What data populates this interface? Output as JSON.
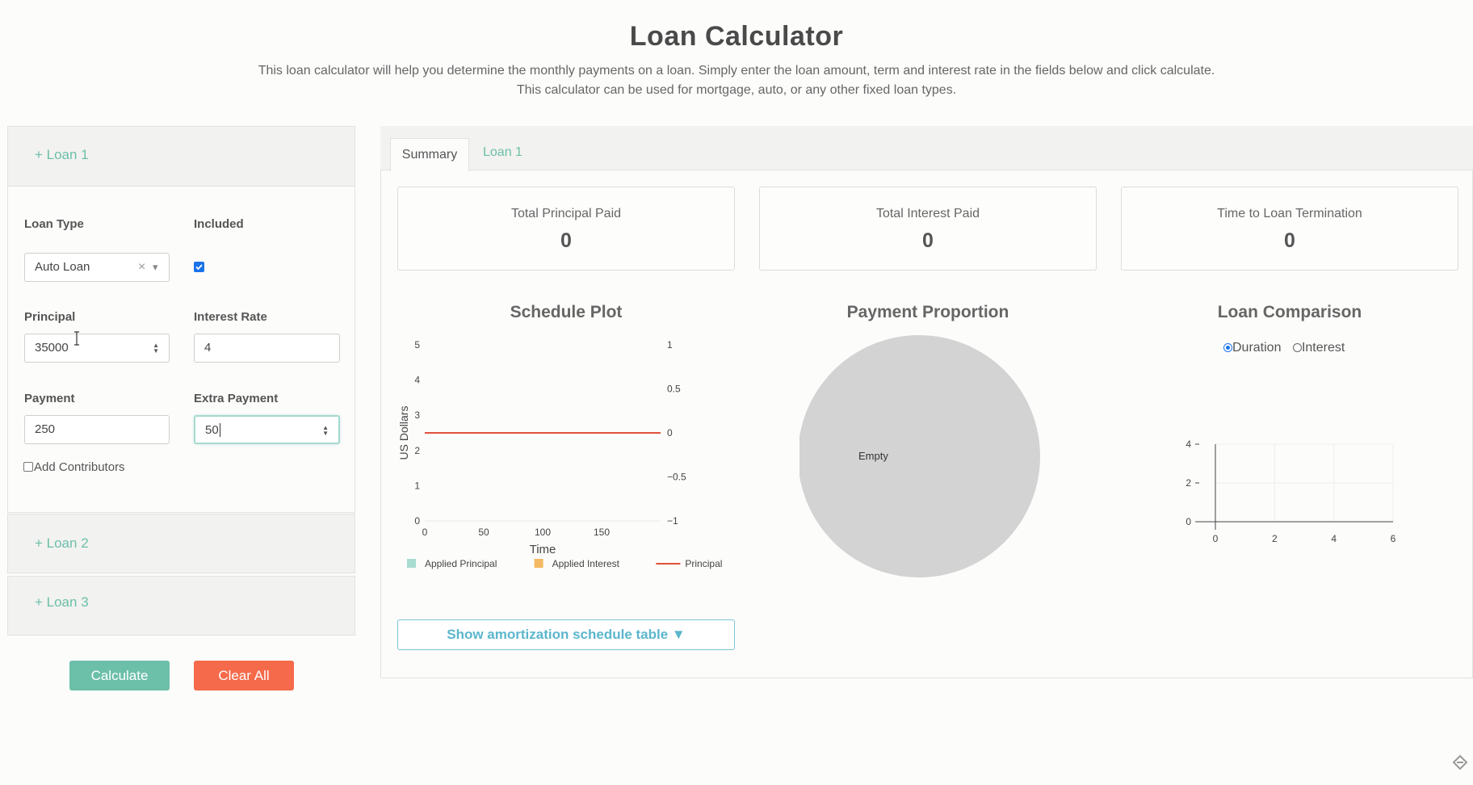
{
  "header": {
    "title": "Loan Calculator",
    "subtitle_line1": "This loan calculator will help you determine the monthly payments on a loan. Simply enter the loan amount, term and interest rate in the fields below and click calculate.",
    "subtitle_line2": "This calculator can be used for mortgage, auto, or any other fixed loan types."
  },
  "loans": {
    "loan1_header": "+ Loan 1",
    "loan2_header": "+ Loan 2",
    "loan3_header": "+ Loan 3",
    "form": {
      "loan_type_label": "Loan Type",
      "loan_type_value": "Auto Loan",
      "included_label": "Included",
      "included_checked": true,
      "principal_label": "Principal",
      "principal_value": "35000",
      "interest_rate_label": "Interest Rate",
      "interest_rate_value": "4",
      "payment_label": "Payment",
      "payment_value": "250",
      "extra_payment_label": "Extra Payment",
      "extra_payment_value": "50",
      "add_contributors_label": "Add Contributors",
      "clear_glyph": "×",
      "dropdown_glyph": "▾"
    }
  },
  "actions": {
    "calculate": "Calculate",
    "clear_all": "Clear All"
  },
  "tabs": {
    "summary": "Summary",
    "loan1": "Loan 1"
  },
  "summary_cards": [
    {
      "label": "Total Principal Paid",
      "value": "0"
    },
    {
      "label": "Total Interest Paid",
      "value": "0"
    },
    {
      "label": "Time to Loan Termination",
      "value": "0"
    }
  ],
  "chart_data": [
    {
      "type": "line",
      "title": "Schedule Plot",
      "xlabel": "Time",
      "ylabel": "US Dollars",
      "x_ticks": [
        "0",
        "50",
        "100",
        "150"
      ],
      "y_ticks": [
        "0",
        "1",
        "2",
        "3",
        "4",
        "5"
      ],
      "y2_ticks": [
        "−1",
        "−0.5",
        "0",
        "0.5",
        "1"
      ],
      "xlim": [
        0,
        200
      ],
      "ylim": [
        0,
        5
      ],
      "y2lim": [
        -1,
        1
      ],
      "series": [
        {
          "name": "Applied Principal",
          "kind": "bar",
          "color": "#a8dcd1",
          "values": []
        },
        {
          "name": "Applied Interest",
          "kind": "bar",
          "color": "#f4b962",
          "values": []
        },
        {
          "name": "Principal",
          "kind": "line",
          "axis": "y2",
          "color": "#e1513a",
          "x": [
            0,
            200
          ],
          "values": [
            0,
            0
          ]
        }
      ],
      "legend_position": "bottom"
    },
    {
      "type": "pie",
      "title": "Payment Proportion",
      "slices": [
        {
          "label": "Empty",
          "value": 1,
          "color": "#d3d3d3"
        }
      ]
    },
    {
      "type": "scatter",
      "title": "Loan Comparison",
      "x_ticks": [
        "0",
        "2",
        "4",
        "6"
      ],
      "y_ticks": [
        "0",
        "2",
        "4"
      ],
      "xlim": [
        0,
        6
      ],
      "ylim": [
        0,
        4
      ],
      "options": [
        {
          "label": "Duration",
          "selected": true
        },
        {
          "label": "Interest",
          "selected": false
        }
      ],
      "series": []
    }
  ],
  "amortization_button": "Show amortization schedule table ▼"
}
